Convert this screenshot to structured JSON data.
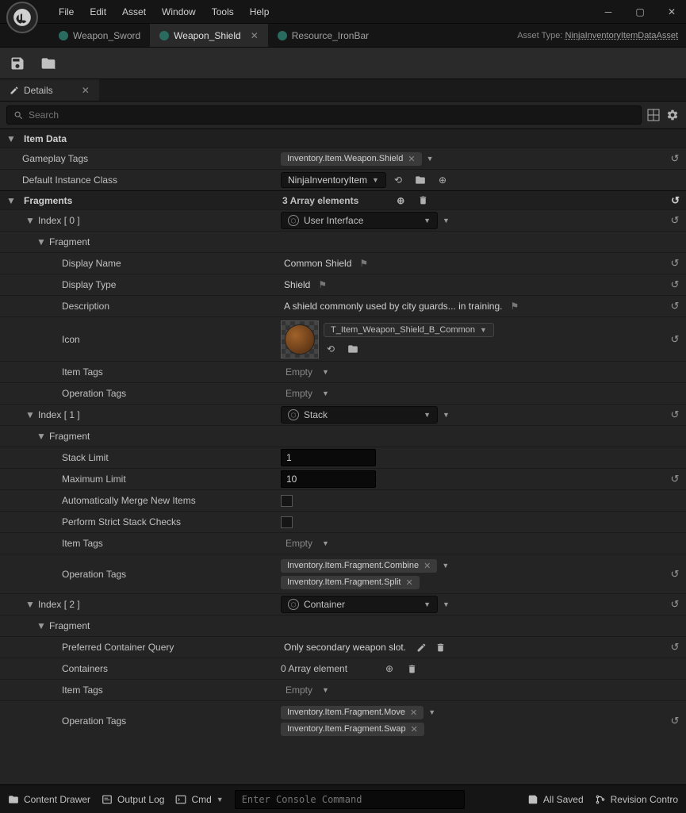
{
  "menu": {
    "file": "File",
    "edit": "Edit",
    "asset": "Asset",
    "window": "Window",
    "tools": "Tools",
    "help": "Help"
  },
  "tabs": [
    {
      "label": "Weapon_Sword"
    },
    {
      "label": "Weapon_Shield"
    },
    {
      "label": "Resource_IronBar"
    }
  ],
  "asset_type_label": "Asset Type:",
  "asset_type_value": "NinjaInventoryItemDataAsset",
  "details_tab": "Details",
  "search_placeholder": "Search",
  "sections": {
    "item_data": "Item Data",
    "fragments_label": "Fragments"
  },
  "labels": {
    "gameplay_tags": "Gameplay Tags",
    "default_instance_class": "Default Instance Class",
    "index": "Index",
    "fragment": "Fragment",
    "display_name": "Display Name",
    "display_type": "Display Type",
    "description": "Description",
    "icon": "Icon",
    "item_tags": "Item Tags",
    "operation_tags": "Operation Tags",
    "stack_limit": "Stack Limit",
    "maximum_limit": "Maximum Limit",
    "auto_merge": "Automatically Merge New Items",
    "strict_stack": "Perform Strict Stack Checks",
    "preferred_container_query": "Preferred Container Query",
    "containers": "Containers",
    "array_elements_3": "3 Array elements",
    "array_elements_0": "0 Array element",
    "empty": "Empty"
  },
  "values": {
    "gameplay_tag": "Inventory.Item.Weapon.Shield",
    "default_class": "NinjaInventoryItem",
    "index0": "0",
    "index1": "1",
    "index2": "2",
    "frag0_type": "User Interface",
    "frag1_type": "Stack",
    "frag2_type": "Container",
    "display_name": "Common Shield",
    "display_type": "Shield",
    "description": "A shield commonly used by city guards... in training.",
    "icon_asset": "T_Item_Weapon_Shield_B_Common",
    "stack_limit": "1",
    "maximum_limit": "10",
    "op_tag_combine": "Inventory.Item.Fragment.Combine",
    "op_tag_split": "Inventory.Item.Fragment.Split",
    "op_tag_move": "Inventory.Item.Fragment.Move",
    "op_tag_swap": "Inventory.Item.Fragment.Swap",
    "container_query": "Only secondary weapon slot."
  },
  "status": {
    "content_drawer": "Content Drawer",
    "output_log": "Output Log",
    "cmd_label": "Cmd",
    "cmd_placeholder": "Enter Console Command",
    "all_saved": "All Saved",
    "revision": "Revision Contro"
  }
}
